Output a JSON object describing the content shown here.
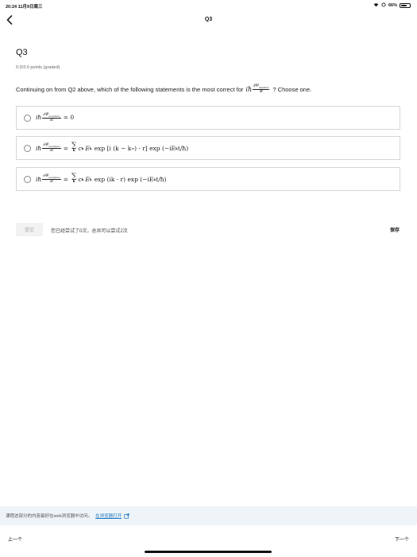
{
  "status_bar": {
    "time": "20:24  11月9日周三",
    "battery": "66%",
    "battery_level": 0.66
  },
  "nav": {
    "title": "Q3"
  },
  "question": {
    "title": "Q3",
    "points": "0.0/3.0 points (graded)",
    "prompt_text": "Continuing on from Q2 above, which of the following statements is the most correct for",
    "prompt_suffix": "? Choose one.",
    "prompt_math_prefix": "iħ",
    "prompt_math_num": "∂Ψ",
    "prompt_math_num_sub": "wavefunc",
    "prompt_math_den": "∂t"
  },
  "options": [
    {
      "prefix": "iħ",
      "num": "∂Ψ",
      "num_sub": "wavefunc",
      "den": "∂t",
      "rhs": "= 0"
    },
    {
      "prefix": "iħ",
      "num": "∂Ψ",
      "num_sub": "wavefunc",
      "den": "∂t",
      "eq": "=",
      "sum_sub": "k",
      "rhs": "c",
      "rhs_rest": "E",
      "k1": "k",
      "k2": "k",
      "term": "exp [i (k − k",
      "m": "m",
      "term2": ") · r] exp (−iE",
      "term3": "t/ħ)"
    },
    {
      "prefix": "iħ",
      "num": "∂Ψ",
      "num_sub": "wavefunc",
      "den": "∂t",
      "eq": "=",
      "sum_sub": "k",
      "rhs": "c",
      "rhs_rest": "E",
      "k1": "k",
      "k2": "k",
      "term": "exp (ik · r) exp (−iE",
      "term3": "t/ħ)"
    }
  ],
  "actions": {
    "submit_label": "提交",
    "attempts_text": "您已经尝试了0次，总共可以尝试2次",
    "save_label": "保存"
  },
  "banner": {
    "text": "课程这部分的内容最好在web浏览器中访问。",
    "link_text": "在浏览器打开"
  },
  "footer": {
    "prev_label": "上一个",
    "next_label": "下一个"
  }
}
